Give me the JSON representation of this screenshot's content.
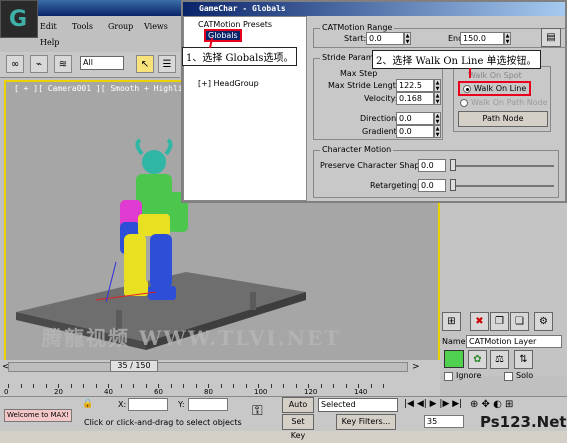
{
  "app": {
    "menu": [
      "Edit",
      "Tools",
      "Group",
      "Views",
      "Help"
    ],
    "toolbar_filter": "All",
    "viewport_label": "[ + ][ Camera001 ][ Smooth + Highlights ]"
  },
  "dialog": {
    "title": "GameChar - Globals",
    "tree": [
      "CATMotion Presets",
      "Globals",
      "[+] HeadGroup"
    ],
    "range_group": "CATMotion Range",
    "start_label": "Start:",
    "start_value": "0.0",
    "end_label": "End:",
    "end_value": "150.0",
    "stride_group": "Stride Parameters",
    "max_step_label": "Max Step",
    "max_stride_label": "Max Stride Length:",
    "max_stride_value": "122.5",
    "velocity_label": "Velocity:",
    "velocity_value": "0.168",
    "direction_label": "Direction:",
    "direction_value": "0.0",
    "gradient_label": "Gradient:",
    "gradient_value": "0.0",
    "walk_on_spot": "Walk On Spot",
    "walk_on_line": "Walk On Line",
    "walk_on_path": "Walk On Path Node",
    "path_node_btn": "Path Node",
    "char_group": "Character Motion",
    "preserve_label": "Preserve Character Shape:",
    "preserve_value": "0.0",
    "retarget_label": "Retargeting:",
    "retarget_value": "0.0"
  },
  "callouts": {
    "step1": "1、选择 Globals选项。",
    "step2": "2、选择 Walk On Line 单选按钮。"
  },
  "command_panel": {
    "name_label": "Name:",
    "name_value": "CATMotion Layer",
    "ignore_label": "Ignore",
    "solo_label": "Solo"
  },
  "timeline": {
    "frame_display": "35 / 150",
    "ticks": [
      "0",
      "20",
      "40",
      "60",
      "80",
      "100",
      "120",
      "140"
    ]
  },
  "status": {
    "script_box": "Welcome to MAX!",
    "prompt": "Click or click-and-drag to select objects",
    "x_label": "X:",
    "y_label": "Y:",
    "auto_key": "Auto Key",
    "selected": "Selected",
    "set_key": "Set Key",
    "key_filters": "Key Filters...",
    "frame_field": "35"
  },
  "branding": {
    "watermark": "腾龍视频 WWW.TLVI.NET",
    "site": "Ps123.Net"
  },
  "colors": {
    "title_blue": "#0a246a",
    "viewport_border": "#e8d200",
    "callout_red": "#e8001c",
    "layer_color": "#4fd14f"
  }
}
